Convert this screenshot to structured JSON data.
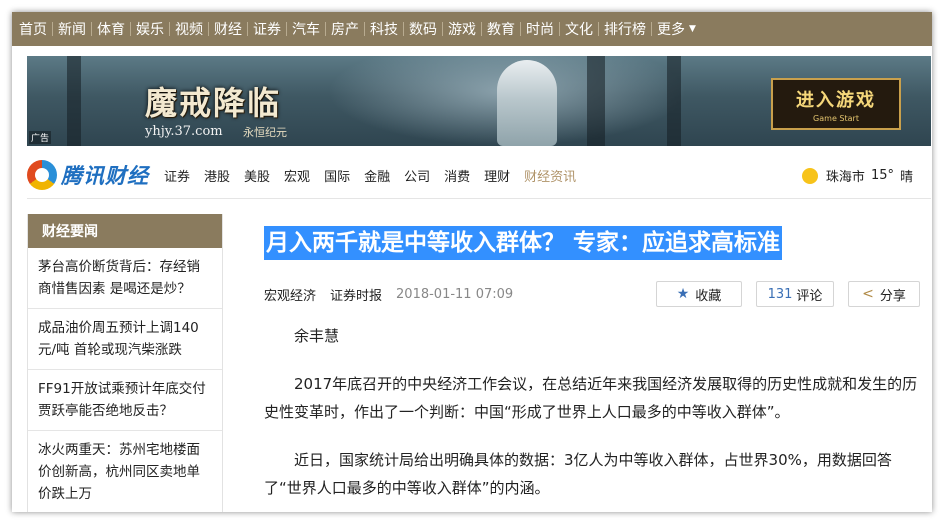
{
  "top_nav": [
    {
      "label": "首页"
    },
    {
      "label": "新闻"
    },
    {
      "label": "体育"
    },
    {
      "label": "娱乐"
    },
    {
      "label": "视频"
    },
    {
      "label": "财经"
    },
    {
      "label": "证券"
    },
    {
      "label": "汽车"
    },
    {
      "label": "房产"
    },
    {
      "label": "科技"
    },
    {
      "label": "数码"
    },
    {
      "label": "游戏"
    },
    {
      "label": "教育"
    },
    {
      "label": "时尚"
    },
    {
      "label": "文化"
    },
    {
      "label": "排行榜"
    },
    {
      "label": "更多"
    }
  ],
  "banner": {
    "game_title": "魔戒降临",
    "url": "yhjy.37.com",
    "subtitle": "永恒纪元",
    "ad_tag": "广告",
    "start_main": "进入游戏",
    "start_en": "Game Start"
  },
  "channel": {
    "brand": "腾讯财经",
    "items": [
      {
        "label": "证券"
      },
      {
        "label": "港股"
      },
      {
        "label": "美股"
      },
      {
        "label": "宏观"
      },
      {
        "label": "国际"
      },
      {
        "label": "金融"
      },
      {
        "label": "公司"
      },
      {
        "label": "消费"
      },
      {
        "label": "理财"
      },
      {
        "label": "财经资讯"
      }
    ],
    "weather": {
      "city": "珠海市",
      "temp": "15°",
      "desc": "晴"
    }
  },
  "sidebar": {
    "title": "财经要闻",
    "items": [
      {
        "text": "茅台高价断货背后：存经销商惜售因素 是喝还是炒？"
      },
      {
        "text": "成品油价周五预计上调140元/吨 首轮或现汽柴涨跌"
      },
      {
        "text": "FF91开放试乘预计年底交付 贾跃亭能否绝地反击？"
      },
      {
        "text": "冰火两重天：苏州宅地楼面价创新高，杭州同区卖地单价跌上万"
      }
    ]
  },
  "article": {
    "title": "月入两千就是中等收入群体？ 专家：应追求高标准",
    "category": "宏观经济",
    "source": "证券时报",
    "time": "2018-01-11 07:09",
    "fav_label": "收藏",
    "comment_count": "131",
    "comment_label": "评论",
    "share_label": "分享",
    "author": "余丰慧",
    "paragraphs": [
      "2017年底召开的中央经济工作会议，在总结近年来我国经济发展取得的历史性成就和发生的历史性变革时，作出了一个判断：中国“形成了世界上人口最多的中等收入群体”。",
      "近日，国家统计局给出明确具体的数据：3亿人为中等收入群体，占世界30%，用数据回答了“世界人口最多的中等收入群体”的内涵。"
    ]
  }
}
